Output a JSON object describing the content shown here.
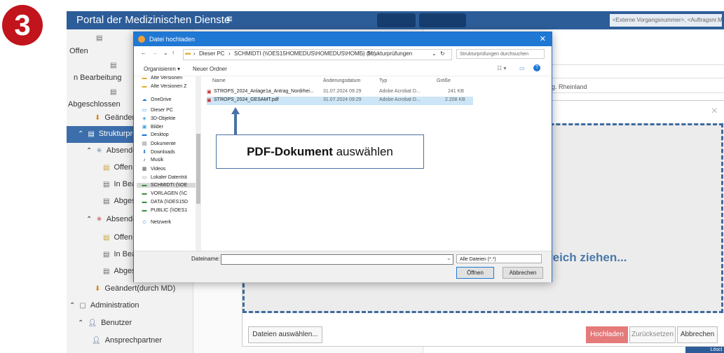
{
  "step": {
    "number": "3"
  },
  "portal": {
    "title": "Portal der Medizinischen Dienste",
    "menu_icon": "≡",
    "ext_field_placeholder": "<Externe Vorgangsnummer>, <Auftragsnr.ME"
  },
  "sidebar": {
    "items": [
      {
        "label": "Offen"
      },
      {
        "label": "n Bearbeitung"
      },
      {
        "label": "Abgeschlossen"
      },
      {
        "label": "Geändert(d"
      },
      {
        "label": "Strukturprüfu"
      },
      {
        "label": "Absender"
      },
      {
        "label": "Offen"
      },
      {
        "label": "In Bearb"
      },
      {
        "label": "Abgesch"
      },
      {
        "label": "Absender"
      },
      {
        "label": "Offen"
      },
      {
        "label": "In Bearb"
      },
      {
        "label": "Abgesch"
      },
      {
        "label": "Geändert(durch MD)"
      },
      {
        "label": "Administration"
      },
      {
        "label": "Benutzer"
      },
      {
        "label": "Ansprechpartner"
      }
    ]
  },
  "rightpane": {
    "region_text": "rg. Rheinland"
  },
  "upload": {
    "close": "×",
    "drop_text": "reich ziehen...",
    "choose_files": "Dateien auswählen...",
    "upload_btn": "Hochladen",
    "reset_btn": "Zurücksetzen",
    "cancel_btn": "Abbrechen",
    "corner_label": "Löscl"
  },
  "file_dialog": {
    "title": "Datei hochladen",
    "close": "✕",
    "breadcrumb": [
      "Dieser PC",
      "SCHMIDTI (\\\\OES15HOMEDUS\\HOMEDUS\\HOME) (H:)",
      "Strukturprüfungen"
    ],
    "search_placeholder": "Strukturprüfungen durchsuchen",
    "organize": "Organisieren ▾",
    "new_folder": "Neuer Ordner",
    "tree": [
      {
        "label": "Alte Versionen",
        "icon": "folder-icon"
      },
      {
        "label": "Alte Versionen Z",
        "icon": "folder-icon"
      },
      {
        "label": "OneDrive",
        "icon": "cloud-icon"
      },
      {
        "label": "Dieser PC",
        "icon": "pc-icon"
      },
      {
        "label": "3D-Objekte",
        "icon": "cube-icon"
      },
      {
        "label": "Bilder",
        "icon": "pictures-icon"
      },
      {
        "label": "Desktop",
        "icon": "desktop-icon"
      },
      {
        "label": "Dokumente",
        "icon": "documents-icon"
      },
      {
        "label": "Downloads",
        "icon": "download-icon"
      },
      {
        "label": "Musik",
        "icon": "music-icon"
      },
      {
        "label": "Videos",
        "icon": "video-icon"
      },
      {
        "label": "Lokaler Datenträ",
        "icon": "drive-icon"
      },
      {
        "label": "SCHMIDTI (\\\\OE",
        "icon": "network-drive-icon"
      },
      {
        "label": "VORLAGEN (\\\\C",
        "icon": "network-drive-icon"
      },
      {
        "label": "DATA (\\\\OES15D",
        "icon": "network-drive-icon"
      },
      {
        "label": "PUBLIC (\\\\OES1",
        "icon": "network-drive-icon"
      },
      {
        "label": "Netzwerk",
        "icon": "network-icon"
      }
    ],
    "columns": {
      "name": "Name",
      "date": "Änderungsdatum",
      "type": "Typ",
      "size": "Größe"
    },
    "files": [
      {
        "name": "STROPS_2024_Anlage1a_Antrag_Nordrhei...",
        "date": "31.07.2024 09:29",
        "type": "Adobe Acrobat D...",
        "size": "241 KB"
      },
      {
        "name": "STROPS_2024_GESAMT.pdf",
        "date": "31.07.2024 09:29",
        "type": "Adobe Acrobat D...",
        "size": "2.208 KB"
      }
    ],
    "filename_label": "Dateiname:",
    "filetype": "Alle Dateien (*.*)",
    "open_btn": "Öffnen",
    "cancel_btn": "Abbrechen"
  },
  "callout": {
    "bold": "PDF-Dokument",
    "rest": " auswählen"
  }
}
